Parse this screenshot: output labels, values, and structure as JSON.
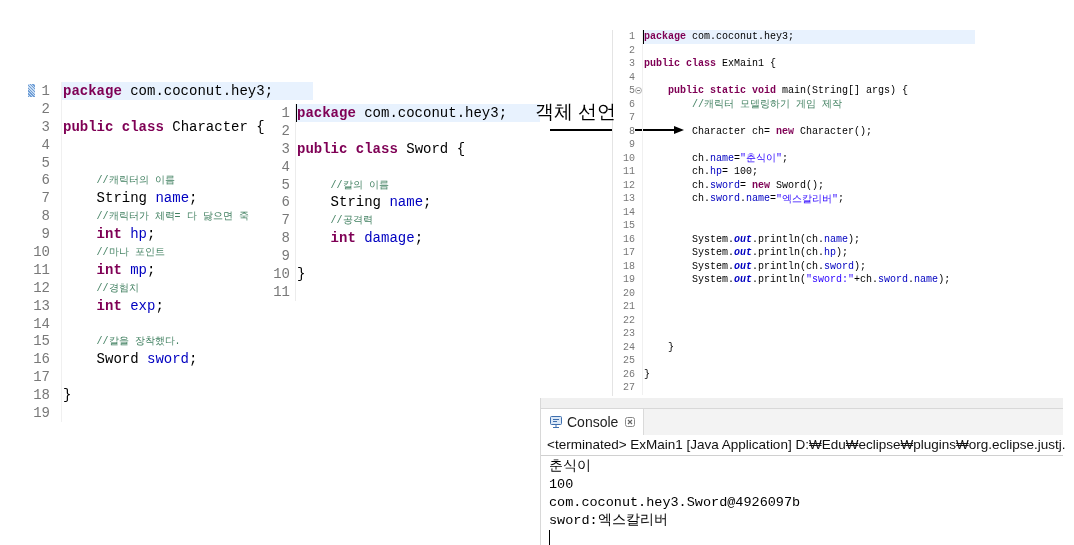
{
  "editors": [
    {
      "lines": [
        {
          "number": "1",
          "current": true,
          "changed": true,
          "tokens": [
            {
              "kind": "keyword",
              "text": "package"
            },
            {
              "kind": "plain",
              "text": " com.coconut.hey3;"
            }
          ]
        },
        {
          "number": "2",
          "current": false
        },
        {
          "number": "3",
          "current": false,
          "tokens": [
            {
              "kind": "keyword",
              "text": "public class"
            },
            {
              "kind": "plain",
              "text": " Character {"
            }
          ]
        },
        {
          "number": "4",
          "current": false
        },
        {
          "number": "5",
          "current": false
        },
        {
          "number": "6",
          "current": false,
          "tokens": [
            {
              "kind": "comment",
              "text": "    //캐릭터의 이름"
            }
          ]
        },
        {
          "number": "7",
          "current": false,
          "tokens": [
            {
              "kind": "plain",
              "text": "    String "
            },
            {
              "kind": "field",
              "text": "name"
            },
            {
              "kind": "plain",
              "text": ";"
            }
          ]
        },
        {
          "number": "8",
          "current": false,
          "tokens": [
            {
              "kind": "comment",
              "text": "    //캐릭터가 체력= 다 닳으면 죽"
            }
          ]
        },
        {
          "number": "9",
          "current": false,
          "tokens": [
            {
              "kind": "keyword",
              "text": "    int"
            },
            {
              "kind": "field",
              "text": " hp"
            },
            {
              "kind": "plain",
              "text": ";"
            }
          ]
        },
        {
          "number": "10",
          "current": false,
          "tokens": [
            {
              "kind": "comment",
              "text": "    //마나 포인트"
            }
          ]
        },
        {
          "number": "11",
          "current": false,
          "tokens": [
            {
              "kind": "keyword",
              "text": "    int"
            },
            {
              "kind": "field",
              "text": " mp"
            },
            {
              "kind": "plain",
              "text": ";"
            }
          ]
        },
        {
          "number": "12",
          "current": false,
          "tokens": [
            {
              "kind": "comment",
              "text": "    //경험치"
            }
          ]
        },
        {
          "number": "13",
          "current": false,
          "tokens": [
            {
              "kind": "keyword",
              "text": "    int"
            },
            {
              "kind": "field",
              "text": " exp"
            },
            {
              "kind": "plain",
              "text": ";"
            }
          ]
        },
        {
          "number": "14",
          "current": false
        },
        {
          "number": "15",
          "current": false,
          "tokens": [
            {
              "kind": "comment",
              "text": "    //칼을 장착했다."
            }
          ]
        },
        {
          "number": "16",
          "current": false,
          "tokens": [
            {
              "kind": "plain",
              "text": "    Sword "
            },
            {
              "kind": "field",
              "text": "sword"
            },
            {
              "kind": "plain",
              "text": ";"
            }
          ]
        },
        {
          "number": "17",
          "current": false
        },
        {
          "number": "18",
          "current": false,
          "tokens": [
            {
              "kind": "plain",
              "text": "}"
            }
          ]
        },
        {
          "number": "19",
          "current": false
        }
      ]
    },
    {
      "lines": [
        {
          "number": "1",
          "current": true,
          "tokens": [
            {
              "kind": "keyword",
              "text": "package"
            },
            {
              "kind": "plain",
              "text": " com.coconut.hey3;"
            }
          ]
        },
        {
          "number": "2",
          "current": false
        },
        {
          "number": "3",
          "current": false,
          "tokens": [
            {
              "kind": "keyword",
              "text": "public class"
            },
            {
              "kind": "plain",
              "text": " Sword {"
            }
          ]
        },
        {
          "number": "4",
          "current": false
        },
        {
          "number": "5",
          "current": false,
          "tokens": [
            {
              "kind": "comment",
              "text": "    //칼의 이름"
            }
          ]
        },
        {
          "number": "6",
          "current": false,
          "tokens": [
            {
              "kind": "plain",
              "text": "    String "
            },
            {
              "kind": "field",
              "text": "name"
            },
            {
              "kind": "plain",
              "text": ";"
            }
          ]
        },
        {
          "number": "7",
          "current": false,
          "tokens": [
            {
              "kind": "comment",
              "text": "    //공격력"
            }
          ]
        },
        {
          "number": "8",
          "current": false,
          "tokens": [
            {
              "kind": "keyword",
              "text": "    int"
            },
            {
              "kind": "field",
              "text": " damage"
            },
            {
              "kind": "plain",
              "text": ";"
            }
          ]
        },
        {
          "number": "9",
          "current": false
        },
        {
          "number": "10",
          "current": false,
          "tokens": [
            {
              "kind": "plain",
              "text": "}"
            }
          ]
        },
        {
          "number": "11",
          "current": false
        }
      ]
    },
    {
      "lines": [
        {
          "number": "1",
          "current": true,
          "tokens": [
            {
              "kind": "keyword",
              "text": "package"
            },
            {
              "kind": "plain",
              "text": " com.coconut.hey3;"
            }
          ]
        },
        {
          "number": "2",
          "current": false
        },
        {
          "number": "3",
          "current": false,
          "tokens": [
            {
              "kind": "keyword",
              "text": "public class"
            },
            {
              "kind": "plain",
              "text": " ExMain1 {"
            }
          ]
        },
        {
          "number": "4",
          "current": false
        },
        {
          "number": "5",
          "current": false,
          "foldable": true,
          "tokens": [
            {
              "kind": "keyword",
              "text": "    public static void"
            },
            {
              "kind": "plain",
              "text": " main(String[] args) {"
            }
          ]
        },
        {
          "number": "6",
          "current": false,
          "tokens": [
            {
              "kind": "comment",
              "text": "        //캐릭터 모델링하기 게임 제작"
            }
          ]
        },
        {
          "number": "7",
          "current": false
        },
        {
          "number": "8",
          "current": false,
          "tokens": [
            {
              "kind": "plain",
              "text": "        Character ch= "
            },
            {
              "kind": "keyword",
              "text": "new"
            },
            {
              "kind": "plain",
              "text": " Character();"
            }
          ]
        },
        {
          "number": "9",
          "current": false
        },
        {
          "number": "10",
          "current": false,
          "tokens": [
            {
              "kind": "plain",
              "text": "        ch."
            },
            {
              "kind": "field",
              "text": "name"
            },
            {
              "kind": "plain",
              "text": "="
            },
            {
              "kind": "string",
              "text": "\"춘식이\""
            },
            {
              "kind": "plain",
              "text": ";"
            }
          ]
        },
        {
          "number": "11",
          "current": false,
          "tokens": [
            {
              "kind": "plain",
              "text": "        ch."
            },
            {
              "kind": "field",
              "text": "hp"
            },
            {
              "kind": "plain",
              "text": "= 100;"
            }
          ]
        },
        {
          "number": "12",
          "current": false,
          "tokens": [
            {
              "kind": "plain",
              "text": "        ch."
            },
            {
              "kind": "field",
              "text": "sword"
            },
            {
              "kind": "plain",
              "text": "= "
            },
            {
              "kind": "keyword",
              "text": "new"
            },
            {
              "kind": "plain",
              "text": " Sword();"
            }
          ]
        },
        {
          "number": "13",
          "current": false,
          "tokens": [
            {
              "kind": "plain",
              "text": "        ch."
            },
            {
              "kind": "field",
              "text": "sword"
            },
            {
              "kind": "plain",
              "text": "."
            },
            {
              "kind": "field",
              "text": "name"
            },
            {
              "kind": "plain",
              "text": "="
            },
            {
              "kind": "string",
              "text": "\"엑스칼리버\""
            },
            {
              "kind": "plain",
              "text": ";"
            }
          ]
        },
        {
          "number": "14",
          "current": false
        },
        {
          "number": "15",
          "current": false
        },
        {
          "number": "16",
          "current": false,
          "tokens": [
            {
              "kind": "plain",
              "text": "        System."
            },
            {
              "kind": "static",
              "text": "out"
            },
            {
              "kind": "plain",
              "text": ".println(ch."
            },
            {
              "kind": "field",
              "text": "name"
            },
            {
              "kind": "plain",
              "text": ");"
            }
          ]
        },
        {
          "number": "17",
          "current": false,
          "tokens": [
            {
              "kind": "plain",
              "text": "        System."
            },
            {
              "kind": "static",
              "text": "out"
            },
            {
              "kind": "plain",
              "text": ".println(ch."
            },
            {
              "kind": "field",
              "text": "hp"
            },
            {
              "kind": "plain",
              "text": ");"
            }
          ]
        },
        {
          "number": "18",
          "current": false,
          "tokens": [
            {
              "kind": "plain",
              "text": "        System."
            },
            {
              "kind": "static",
              "text": "out"
            },
            {
              "kind": "plain",
              "text": ".println(ch."
            },
            {
              "kind": "field",
              "text": "sword"
            },
            {
              "kind": "plain",
              "text": ");"
            }
          ]
        },
        {
          "number": "19",
          "current": false,
          "tokens": [
            {
              "kind": "plain",
              "text": "        System."
            },
            {
              "kind": "static",
              "text": "out"
            },
            {
              "kind": "plain",
              "text": ".println("
            },
            {
              "kind": "string",
              "text": "\"sword:\""
            },
            {
              "kind": "plain",
              "text": "+ch."
            },
            {
              "kind": "field",
              "text": "sword"
            },
            {
              "kind": "plain",
              "text": "."
            },
            {
              "kind": "field",
              "text": "name"
            },
            {
              "kind": "plain",
              "text": ");"
            }
          ]
        },
        {
          "number": "20",
          "current": false
        },
        {
          "number": "21",
          "current": false
        },
        {
          "number": "22",
          "current": false
        },
        {
          "number": "23",
          "current": false
        },
        {
          "number": "24",
          "current": false,
          "tokens": [
            {
              "kind": "plain",
              "text": "    }"
            }
          ]
        },
        {
          "number": "25",
          "current": false
        },
        {
          "number": "26",
          "current": false,
          "tokens": [
            {
              "kind": "plain",
              "text": "}"
            }
          ]
        },
        {
          "number": "27",
          "current": false
        }
      ]
    }
  ],
  "annotation": {
    "label": "객체 선언"
  },
  "console": {
    "tab": "Console",
    "header": "<terminated> ExMain1 [Java Application] D:₩Edu₩eclipse₩plugins₩org.eclipse.justj.",
    "output": [
      "춘식이",
      "100",
      "com.coconut.hey3.Sword@4926097b",
      "sword:엑스칼리버"
    ]
  }
}
